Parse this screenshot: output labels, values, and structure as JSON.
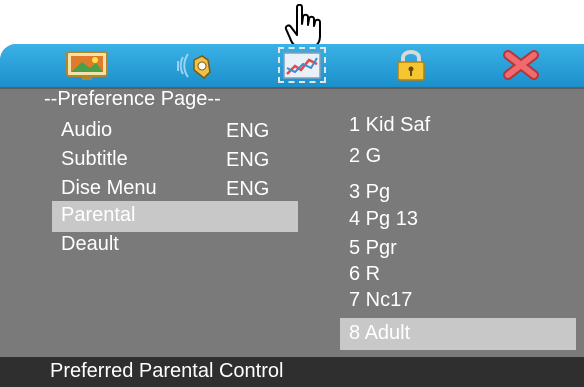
{
  "header": {
    "tabs": [
      {
        "name": "picture",
        "icon": "tv-picture-icon"
      },
      {
        "name": "audio",
        "icon": "speaker-icon"
      },
      {
        "name": "preference",
        "icon": "preference-chart-icon",
        "selected": true
      },
      {
        "name": "password",
        "icon": "padlock-icon"
      },
      {
        "name": "exit",
        "icon": "red-x-close-icon"
      }
    ]
  },
  "page_title": "--Preference Page--",
  "menu": {
    "items": [
      {
        "label": "Audio",
        "value": "ENG"
      },
      {
        "label": "Subtitle",
        "value": "ENG"
      },
      {
        "label": "Dise Menu",
        "value": "ENG"
      },
      {
        "label": "Parental",
        "value": "",
        "selected": true
      },
      {
        "label": "Deault",
        "value": ""
      }
    ]
  },
  "options": {
    "items": [
      {
        "label": "1 Kid Saf"
      },
      {
        "label": "2 G"
      },
      {
        "label": "3 Pg"
      },
      {
        "label": "4 Pg 13"
      },
      {
        "label": "5 Pgr"
      },
      {
        "label": "6 R"
      },
      {
        "label": "7 Nc17"
      },
      {
        "label": "8 Adult",
        "selected": true
      }
    ]
  },
  "status_text": "Preferred Parental Control",
  "colors": {
    "icon_bar": "#2aa3df",
    "panel": "#7a7a7a",
    "highlight": "#c8c8c8",
    "status_bar": "#2f2f2f",
    "text": "#ffffff"
  }
}
